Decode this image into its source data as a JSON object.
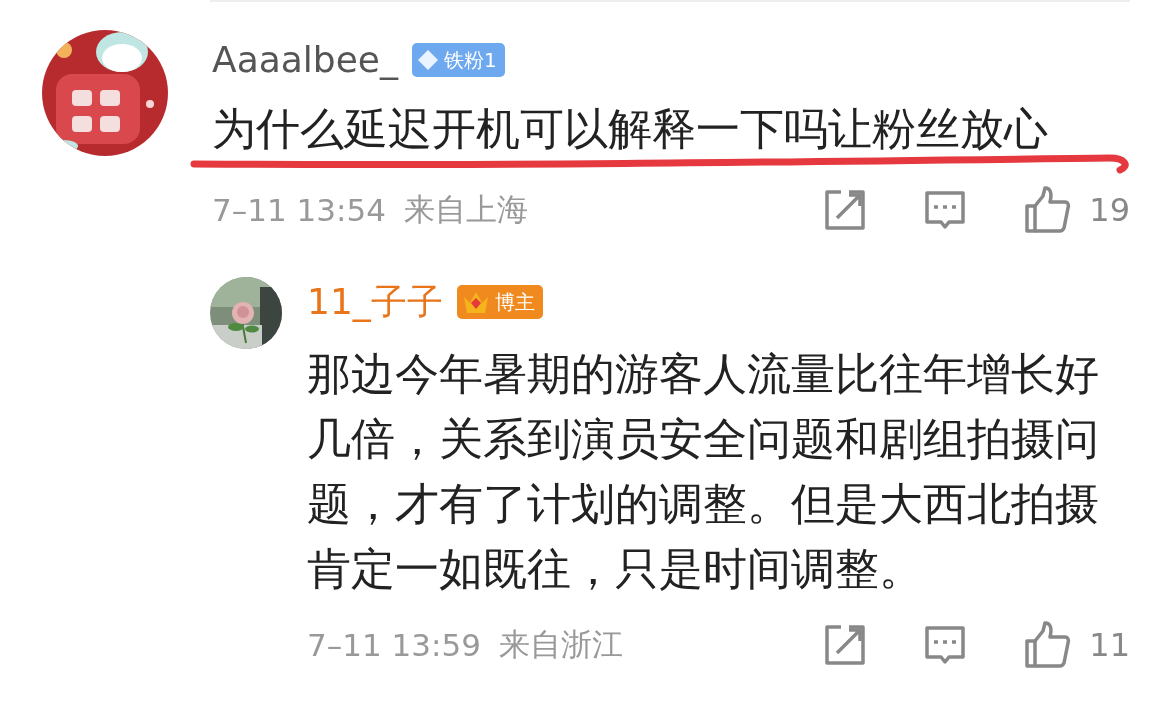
{
  "comments": [
    {
      "kind": "comment",
      "author": "Aaaalbee_",
      "badge": {
        "kind": "fan",
        "label": "铁粉1"
      },
      "text": "为什么延迟开机可以解释一下吗让粉丝放心",
      "underlined": true,
      "time": "7–11 13:54",
      "location": "来自上海",
      "likes": "19"
    },
    {
      "kind": "reply",
      "author": "11_子子",
      "badge": {
        "kind": "blogger",
        "label": "博主"
      },
      "text": "那边今年暑期的游客人流量比往年增长好几倍，关系到演员安全问题和剧组拍摄问题，才有了计划的调整。但是大西北拍摄肯定一如既往，只是时间调整。",
      "time": "7–11 13:59",
      "location": "来自浙江",
      "likes": "11"
    }
  ]
}
